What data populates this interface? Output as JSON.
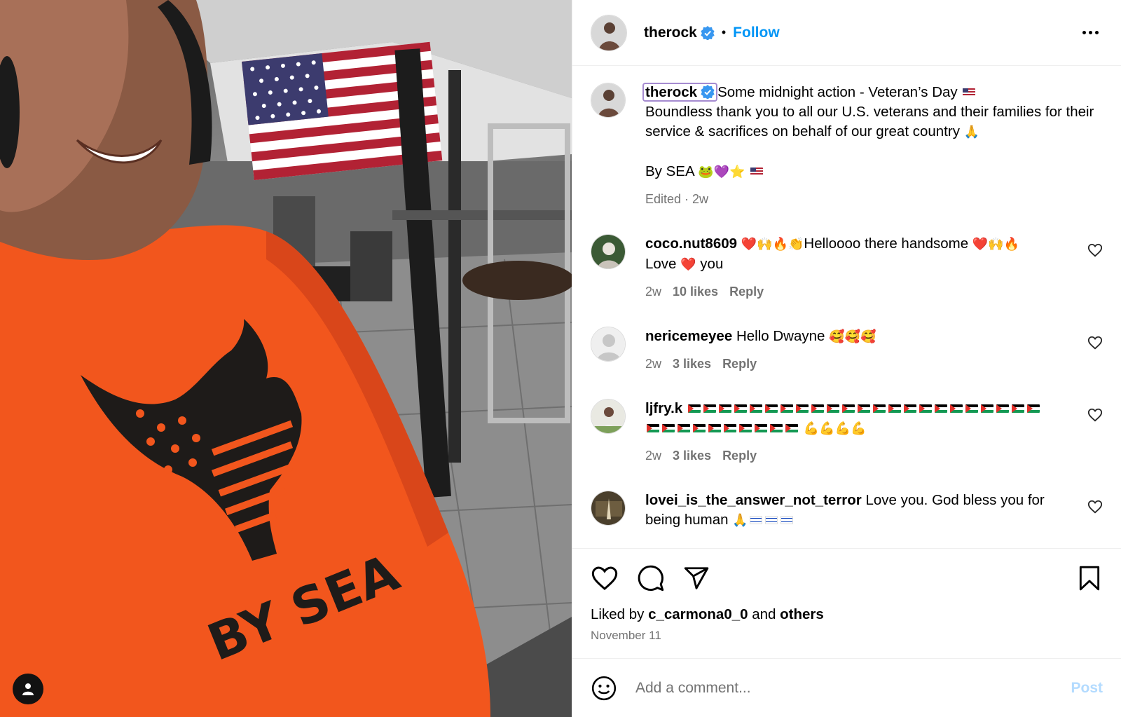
{
  "post": {
    "author": "therock",
    "follow_label": "Follow",
    "separator": "•"
  },
  "caption": {
    "username": "therock",
    "line1": "Some midnight action - Veteran’s Day",
    "line2": "Boundless thank you to all our U.S. veterans and their families for their service & sacrifices on behalf of our great country",
    "line3": "By SEA",
    "meta": "Edited · 2w"
  },
  "comments": [
    {
      "username": "coco.nut8609",
      "text_a": "Helloooo there handsome",
      "text_b": "Love",
      "text_c": "you",
      "time": "2w",
      "likes": "10 likes",
      "reply": "Reply"
    },
    {
      "username": "nericemeyee",
      "text_a": "Hello Dwayne",
      "time": "2w",
      "likes": "3 likes",
      "reply": "Reply"
    },
    {
      "username": "ljfry.k",
      "time": "2w",
      "likes": "3 likes",
      "reply": "Reply"
    },
    {
      "username": "lovei_is_the_answer_not_terror",
      "text_a": "Love you. God bless you for being human"
    }
  ],
  "engagement": {
    "liked_by_prefix": "Liked by",
    "liked_by_user": "c_carmona0_0",
    "and": "and",
    "others": "others",
    "date": "November 11"
  },
  "composer": {
    "placeholder": "Add a comment...",
    "post_label": "Post"
  },
  "photo_text": {
    "shirt_text": "BY SEA"
  },
  "colors": {
    "accent": "#0095f6",
    "shirt": "#f2561d",
    "post_disabled": "#b3dbff"
  },
  "icons": [
    "verified-badge-icon",
    "more-options-icon",
    "heart-icon",
    "comment-icon",
    "share-icon",
    "bookmark-icon",
    "emoji-icon",
    "user-tag-icon"
  ]
}
